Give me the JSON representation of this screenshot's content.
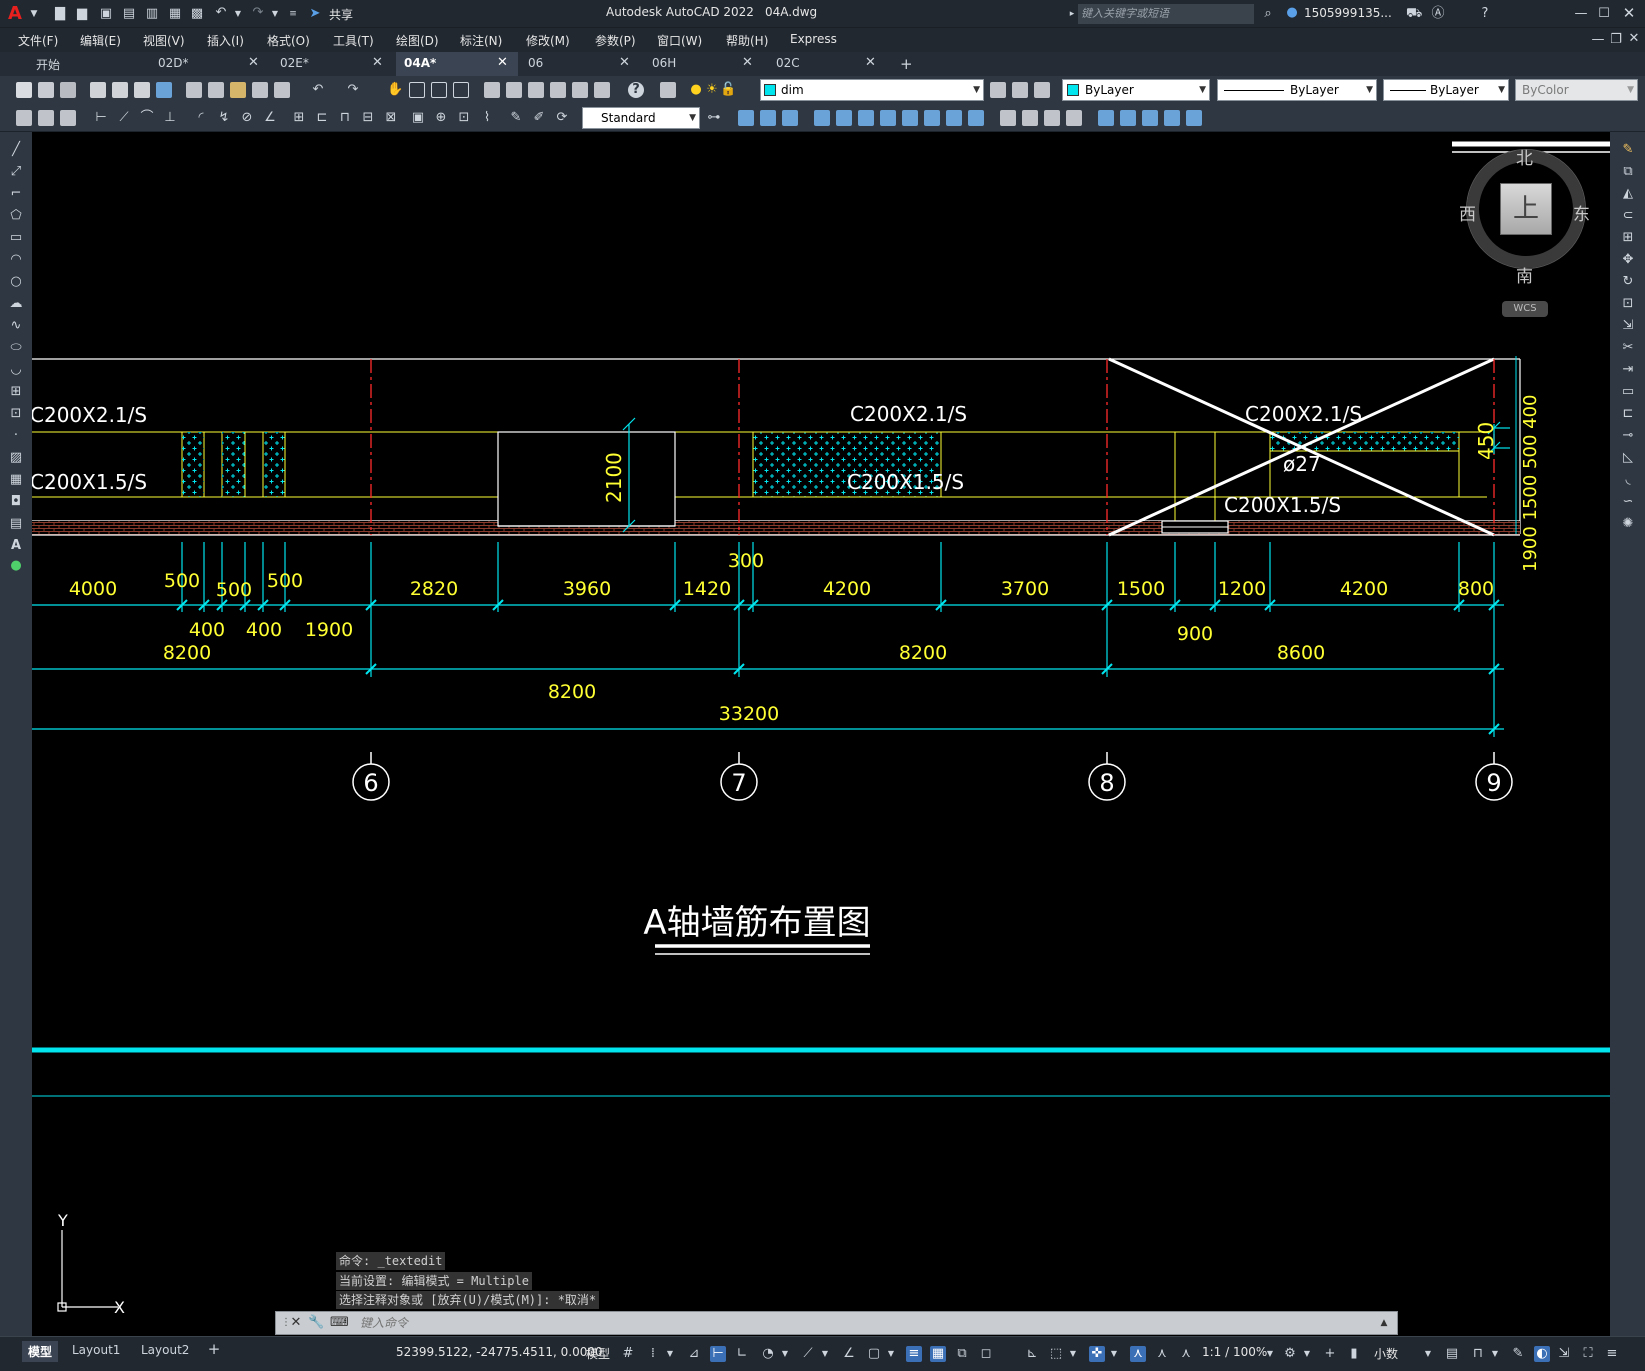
{
  "app": {
    "title": "Autodesk AutoCAD 2022",
    "filename": "04A.dwg",
    "share_label": "共享",
    "search_placeholder": "键入关键字或短语",
    "user": "1505999135...",
    "logo_letter": "A"
  },
  "menu": [
    "文件(F)",
    "编辑(E)",
    "视图(V)",
    "插入(I)",
    "格式(O)",
    "工具(T)",
    "绘图(D)",
    "标注(N)",
    "修改(M)",
    "参数(P)",
    "窗口(W)",
    "帮助(H)",
    "Express"
  ],
  "tabs": [
    {
      "label": "开始",
      "closable": false,
      "active": false
    },
    {
      "label": "02D*",
      "closable": true,
      "active": false
    },
    {
      "label": "02E*",
      "closable": true,
      "active": false
    },
    {
      "label": "04A*",
      "closable": true,
      "active": true
    },
    {
      "label": "06",
      "closable": true,
      "active": false
    },
    {
      "label": "06H",
      "closable": true,
      "active": false
    },
    {
      "label": "02C",
      "closable": true,
      "active": false
    }
  ],
  "toolbar": {
    "layer_value": "dim",
    "color_value": "ByLayer",
    "linetype_value": "ByLayer",
    "lineweight_value": "ByLayer",
    "plotstyle_value": "ByColor",
    "textstyle_value": "Standard"
  },
  "viewcube": {
    "north": "北",
    "south": "南",
    "east": "东",
    "west": "西",
    "top": "上",
    "wcs": "WCS"
  },
  "colors": {
    "cyan": "#00e5ee",
    "yellow": "#ffff33",
    "red": "#ff2a2a",
    "white": "#ffffff",
    "ui_dark": "#212830",
    "ui_mid": "#2f3742"
  },
  "drawing": {
    "labels": {
      "c21_left": "C200X2.1/S",
      "c15_left": "C200X1.5/S",
      "c21_mid": "C200X2.1/S",
      "c15_mid": "C200X1.5/S",
      "c21_right": "C200X2.1/S",
      "c15_right": "C200X1.5/S",
      "phi": "ø27",
      "h2100": "2100",
      "h450": "450",
      "right_vert": "1900 1500 500 400"
    },
    "dims_row1": [
      "4000",
      "500",
      "500",
      "500",
      "2820",
      "3960",
      "300",
      "1420",
      "4200",
      "3700",
      "1500",
      "1200",
      "4200",
      "800"
    ],
    "dims_row2": [
      "400",
      "400",
      "1900",
      "900"
    ],
    "dims_row3": [
      "8200",
      "8200",
      "8600"
    ],
    "dims_row4": [
      "8200"
    ],
    "dims_total": "33200",
    "axes": [
      "6",
      "7",
      "8",
      "9"
    ],
    "title": "A轴墙筋布置图"
  },
  "ucs": {
    "x": "X",
    "y": "Y"
  },
  "command": {
    "history": [
      "命令: _textedit",
      "当前设置: 编辑模式 = Multiple",
      "选择注释对象或 [放弃(U)/模式(M)]: *取消*"
    ],
    "placeholder": "键入命令"
  },
  "layouts": [
    "模型",
    "Layout1",
    "Layout2"
  ],
  "status": {
    "coords": "52399.5122, -24775.4511, 0.0000",
    "model": "模型",
    "scale": "1:1 / 100%",
    "units": "小数"
  }
}
